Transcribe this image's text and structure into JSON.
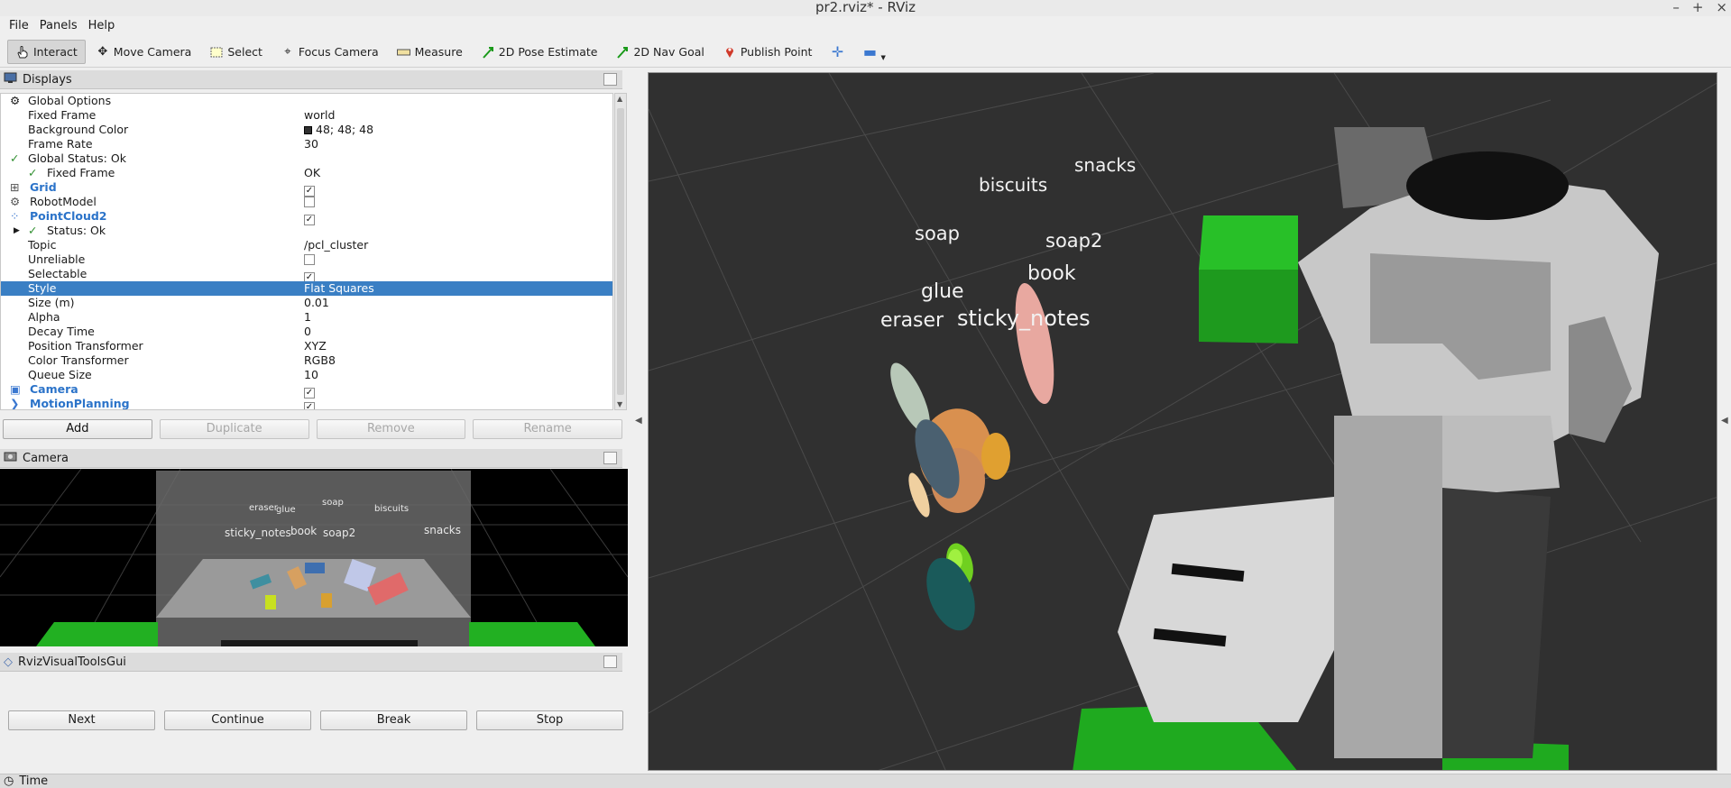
{
  "window": {
    "title": "pr2.rviz* - RViz"
  },
  "menu": [
    "File",
    "Panels",
    "Help"
  ],
  "toolbar": {
    "interact": "Interact",
    "move_camera": "Move Camera",
    "select": "Select",
    "focus_camera": "Focus Camera",
    "measure": "Measure",
    "pose_estimate": "2D Pose Estimate",
    "nav_goal": "2D Nav Goal",
    "publish_point": "Publish Point"
  },
  "displays": {
    "title": "Displays",
    "rows": [
      {
        "label": "Global Options",
        "value": ""
      },
      {
        "label": "Fixed Frame",
        "value": "world"
      },
      {
        "label": "Background Color",
        "value": "48; 48; 48"
      },
      {
        "label": "Frame Rate",
        "value": "30"
      },
      {
        "label": "Global Status: Ok",
        "value": ""
      },
      {
        "label": "Fixed Frame",
        "value": "OK"
      },
      {
        "label": "Grid",
        "value": ""
      },
      {
        "label": "RobotModel",
        "value": ""
      },
      {
        "label": "PointCloud2",
        "value": ""
      },
      {
        "label": "Status: Ok",
        "value": ""
      },
      {
        "label": "Topic",
        "value": "/pcl_cluster"
      },
      {
        "label": "Unreliable",
        "value": ""
      },
      {
        "label": "Selectable",
        "value": ""
      },
      {
        "label": "Style",
        "value": "Flat Squares"
      },
      {
        "label": "Size (m)",
        "value": "0.01"
      },
      {
        "label": "Alpha",
        "value": "1"
      },
      {
        "label": "Decay Time",
        "value": "0"
      },
      {
        "label": "Position Transformer",
        "value": "XYZ"
      },
      {
        "label": "Color Transformer",
        "value": "RGB8"
      },
      {
        "label": "Queue Size",
        "value": "10"
      },
      {
        "label": "Camera",
        "value": ""
      },
      {
        "label": "MotionPlanning",
        "value": ""
      }
    ],
    "buttons": {
      "add": "Add",
      "duplicate": "Duplicate",
      "remove": "Remove",
      "rename": "Rename"
    }
  },
  "camera_panel": {
    "title": "Camera",
    "labels": [
      "eraser",
      "glue",
      "soap",
      "biscuits",
      "sticky_notes",
      "book",
      "soap2",
      "snacks"
    ]
  },
  "tools_gui": {
    "title": "RvizVisualToolsGui",
    "next": "Next",
    "continue": "Continue",
    "break": "Break",
    "stop": "Stop"
  },
  "scene_labels": [
    "snacks",
    "biscuits",
    "soap",
    "soap2",
    "book",
    "glue",
    "eraser",
    "sticky_notes"
  ],
  "time_panel": {
    "title": "Time"
  },
  "colors": {
    "background": "#303030",
    "selection": "#3a7fc4",
    "accent_blue": "#2b73c9"
  }
}
